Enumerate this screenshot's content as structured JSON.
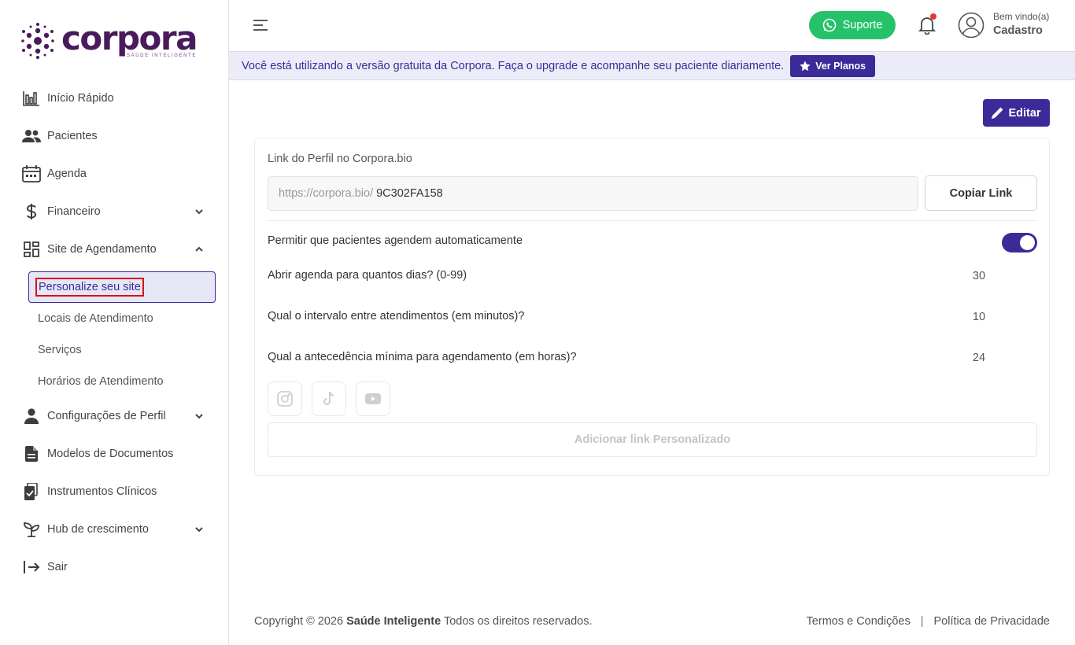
{
  "brand": {
    "name": "corpora",
    "tagline": "SAÚDE INTELIGENTE",
    "colors": {
      "primary": "#3b2b99",
      "logo": "#4a1b5c",
      "whatsapp": "#25c26a"
    }
  },
  "sidebar": {
    "items": [
      {
        "label": "Início Rápido",
        "icon": "bar-chart-icon"
      },
      {
        "label": "Pacientes",
        "icon": "users-icon"
      },
      {
        "label": "Agenda",
        "icon": "calendar-icon"
      },
      {
        "label": "Financeiro",
        "icon": "dollar-icon",
        "expandable": true
      },
      {
        "label": "Site de Agendamento",
        "icon": "grid-icon",
        "expanded": true
      },
      {
        "label": "Configurações de Perfil",
        "icon": "user-icon",
        "expandable": true
      },
      {
        "label": "Modelos de Documentos",
        "icon": "document-icon"
      },
      {
        "label": "Instrumentos Clínicos",
        "icon": "clipboard-icon"
      },
      {
        "label": "Hub de crescimento",
        "icon": "sprout-icon",
        "expandable": true
      },
      {
        "label": "Sair",
        "icon": "logout-icon"
      }
    ],
    "subitems": [
      {
        "label": "Personalize seu site",
        "active": true
      },
      {
        "label": "Locais de Atendimento"
      },
      {
        "label": "Serviços"
      },
      {
        "label": "Horários de Atendimento"
      }
    ]
  },
  "header": {
    "support_label": "Suporte",
    "welcome": "Bem vindo(a)",
    "user_name": "Cadastro"
  },
  "banner": {
    "text": "Você está utilizando a versão gratuita da Corpora. Faça o upgrade e acompanhe seu paciente diariamente.",
    "button_label": "Ver Planos"
  },
  "main": {
    "edit_label": "Editar",
    "profile_link_label": "Link do Perfil no Corpora.bio",
    "link_prefix": "https://corpora.bio/",
    "link_code": "9C302FA158",
    "copy_label": "Copiar Link",
    "auto_schedule_label": "Permitir que pacientes agendem automaticamente",
    "auto_schedule_enabled": true,
    "settings": [
      {
        "label": "Abrir agenda para quantos dias? (0-99)",
        "value": "30"
      },
      {
        "label": "Qual o intervalo entre atendimentos (em minutos)?",
        "value": "10"
      },
      {
        "label": "Qual a antecedência mínima para agendamento (em horas)?",
        "value": "24"
      }
    ],
    "social_icons": [
      "instagram-icon",
      "tiktok-icon",
      "youtube-icon"
    ],
    "add_link_label": "Adicionar link Personalizado"
  },
  "footer": {
    "copyright_prefix": "Copyright © 2026",
    "copyright_brand": "Saúde Inteligente",
    "copyright_suffix": "Todos os direitos reservados.",
    "terms": "Termos e Condições",
    "privacy": "Política de Privacidade"
  }
}
